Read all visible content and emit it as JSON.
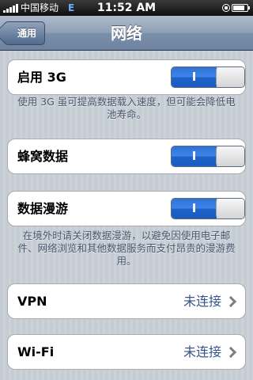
{
  "status_bar": {
    "carrier": "中国移动",
    "network": "E",
    "time": "11:52 AM",
    "battery_level": 0.85
  },
  "nav": {
    "back_label": "通用",
    "title": "网络"
  },
  "cells": {
    "enable_3g": {
      "label": "启用 3G",
      "switch_text": "I"
    },
    "cellular_data": {
      "label": "蜂窝数据",
      "switch_text": "I"
    },
    "data_roaming": {
      "label": "数据漫游",
      "switch_text": "I"
    },
    "vpn": {
      "label": "VPN",
      "value": "未连接"
    },
    "wifi": {
      "label": "Wi-Fi",
      "value": "未连接"
    }
  },
  "footnotes": {
    "enable_3g": "使用 3G 虽可提高数据载入速度，但可能会降低电池寿命。",
    "roaming": "在境外时请关闭数据漫游，以避免因使用电子邮件、网络浏览和其他数据服务而支付昂贵的漫游费用。"
  },
  "colors": {
    "switch_on": "#2f72d6",
    "value_text": "#385487",
    "background": "#c5ccd4"
  }
}
